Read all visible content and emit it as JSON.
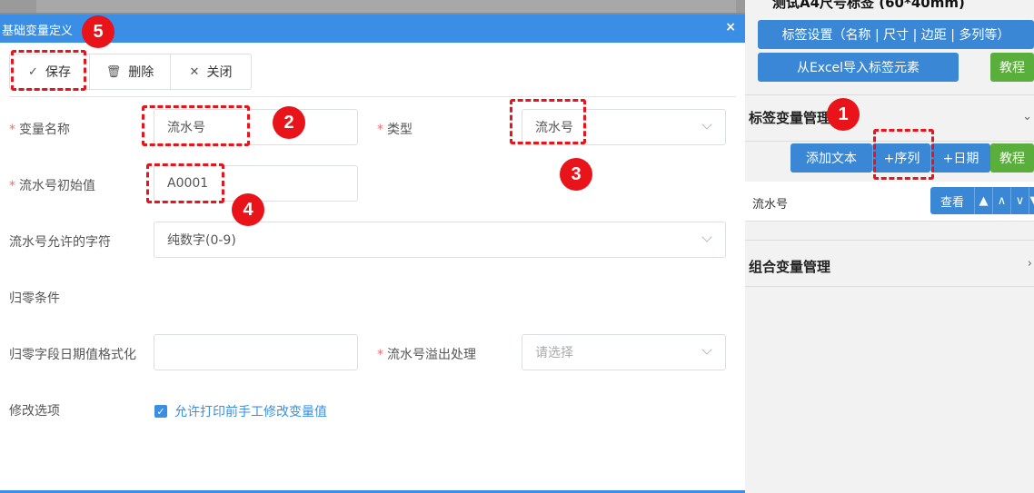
{
  "background": {
    "title": "测试A4尺号标签 (60*40mm)",
    "buttons": {
      "label_settings": "标签设置（名称 | 尺寸 | 边距 | 多列等）",
      "import_excel": "从Excel导入标签元素",
      "tutorial": "教程"
    },
    "variable_section": {
      "title": "标签变量管理",
      "add_text": "添加文本",
      "add_sequence": "+序列",
      "add_date": "+日期",
      "tutorial": "教程",
      "row_label": "流水号",
      "view": "查看",
      "arrows": [
        "▲",
        "∧",
        "∨",
        "▼"
      ]
    },
    "combo_section": {
      "title": "组合变量管理"
    }
  },
  "dialog": {
    "title": "基础变量定义",
    "close": "×",
    "toolbar": {
      "save": "保存",
      "delete": "删除",
      "close": "关闭"
    },
    "form": {
      "name_label": "变量名称",
      "name_value": "流水号",
      "type_label": "类型",
      "type_value": "流水号",
      "initial_label": "流水号初始值",
      "initial_value": "A0001",
      "allowed_label": "流水号允许的字符",
      "allowed_value": "纯数字(0-9)",
      "reset_label": "归零条件",
      "date_format_label": "归零字段日期值格式化",
      "date_format_value": "",
      "overflow_label": "流水号溢出处理",
      "overflow_placeholder": "请选择",
      "modify_label": "修改选项",
      "modify_checkbox": "允许打印前手工修改变量值"
    }
  },
  "annotations": [
    "1",
    "2",
    "3",
    "4",
    "5"
  ],
  "colors": {
    "primary_blue": "#3a8ee6",
    "green": "#5aae3c",
    "annotation_red": "#e8141a",
    "required_red": "#f56c6c"
  }
}
